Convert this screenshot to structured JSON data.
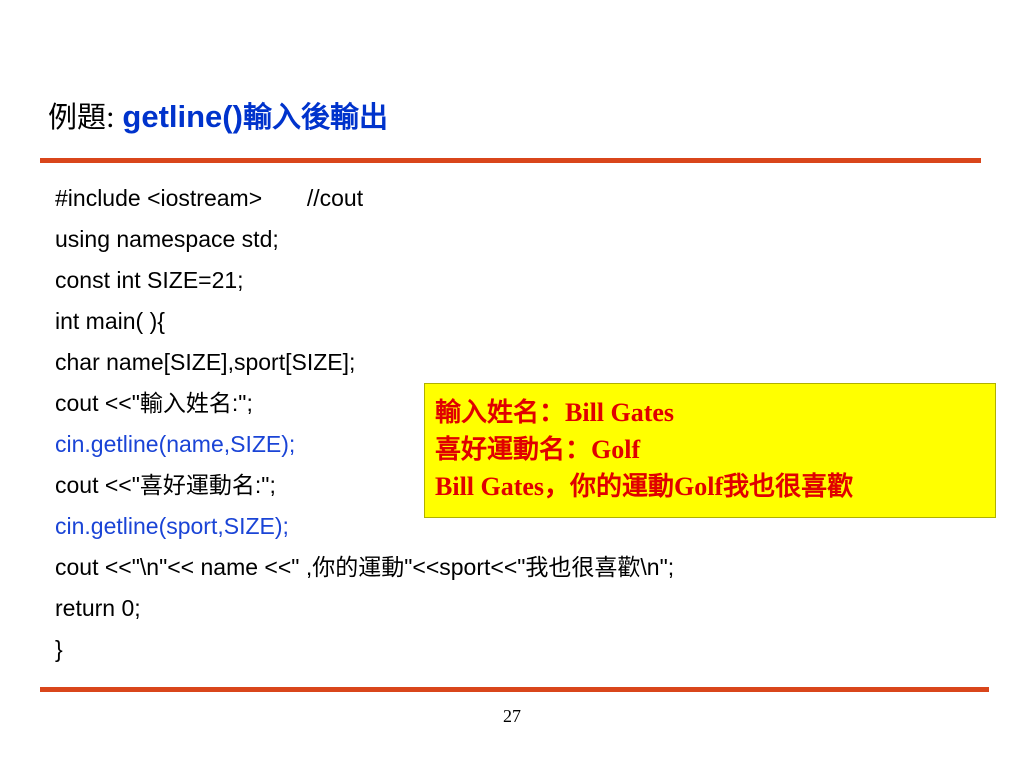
{
  "title": {
    "prefix": "例題",
    "separator": ": ",
    "main": "getline()",
    "suffix": "輸入後輸出"
  },
  "code_lines": [
    {
      "text": "#include <iostream>       //cout",
      "color": "#000000"
    },
    {
      "text": "using namespace std;",
      "color": "#000000"
    },
    {
      "text": "const int SIZE=21;",
      "color": "#000000"
    },
    {
      "text": "int main( ){",
      "color": "#000000"
    },
    {
      "text": "char name[SIZE],sport[SIZE];",
      "color": "#000000"
    },
    {
      "text": "cout <<\"輸入姓名:\";",
      "color": "#000000"
    },
    {
      "text": "cin.getline(name,SIZE);",
      "color": "#1a44d6"
    },
    {
      "text": "cout <<\"喜好運動名:\";",
      "color": "#000000"
    },
    {
      "text": "cin.getline(sport,SIZE);",
      "color": "#1a44d6"
    },
    {
      "text": "cout <<\"\\n\"<< name <<\" ,你的運動\"<<sport<<\"我也很喜歡\\n\";",
      "color": "#000000"
    },
    {
      "text": "return 0;",
      "color": "#000000"
    },
    {
      "text": "}",
      "color": "#000000"
    }
  ],
  "callout": {
    "lines": [
      "輸入姓名：Bill Gates",
      "喜好運動名：Golf",
      "Bill Gates，你的運動Golf我也很喜歡"
    ],
    "background": "#ffff00",
    "text_color": "#e00000"
  },
  "page_number": "27",
  "accent_color": "#d9461b"
}
